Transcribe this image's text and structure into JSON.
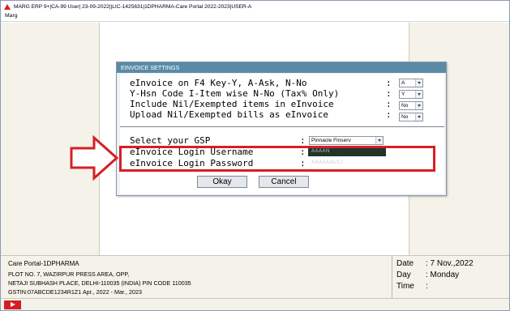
{
  "window": {
    "title": "MARG ERP 9+|CA-99 User| 23-09-2022||LIC-1425631|1DPHARMA-Care Portal 2022-2023|USER-A"
  },
  "menubar": {
    "items": [
      "Marg"
    ]
  },
  "dialog": {
    "title": "EINVOICE SETTINGS",
    "settings": [
      {
        "label": "eInvoice on F4 Key-Y, A-Ask, N-No",
        "value": "A"
      },
      {
        "label": "Y-Hsn Code I-Item wise N-No (Tax% Only)",
        "value": "Y"
      },
      {
        "label": "Include Nil/Exempted items in eInvoice",
        "value": "No"
      },
      {
        "label": "Upload Nil/Exempted bills as eInvoice",
        "value": "No"
      }
    ],
    "gsp": {
      "label": "Select your GSP",
      "value": "Pinnacle Finserv"
    },
    "login_username": {
      "label": "eInvoice Login Username",
      "value": "AAAAN"
    },
    "login_password": {
      "label": "eInvoice Login Password",
      "value": "AAAAAAU12"
    },
    "ok_label": "Okay",
    "cancel_label": "Cancel"
  },
  "footer": {
    "company": "Care Portal-1DPHARMA",
    "address_line1": "PLOT NO. 7, WAZIRPUR PRESS AREA, OPP,",
    "address_line2": "NETAJI SUBHASH PLACE, DELHI-110035 (INDIA) PIN CODE 110035",
    "gstin_line": "GSTIN:07ABCDE1234R1Z1  Apr., 2022 - Mar., 2023",
    "date_label": "Date",
    "date_value": ": 7 Nov.,2022",
    "day_label": "Day",
    "day_value": ": Monday",
    "time_label": "Time",
    "time_value": ":"
  },
  "colors": {
    "dialog_title_bg": "#5a8ba6",
    "highlight": "#d61f26",
    "workarea_bg": "#f5f2e9"
  },
  "icons": [
    "marg-logo-icon",
    "chevron-down-icon",
    "callout-arrow-icon",
    "status-action-icon"
  ]
}
